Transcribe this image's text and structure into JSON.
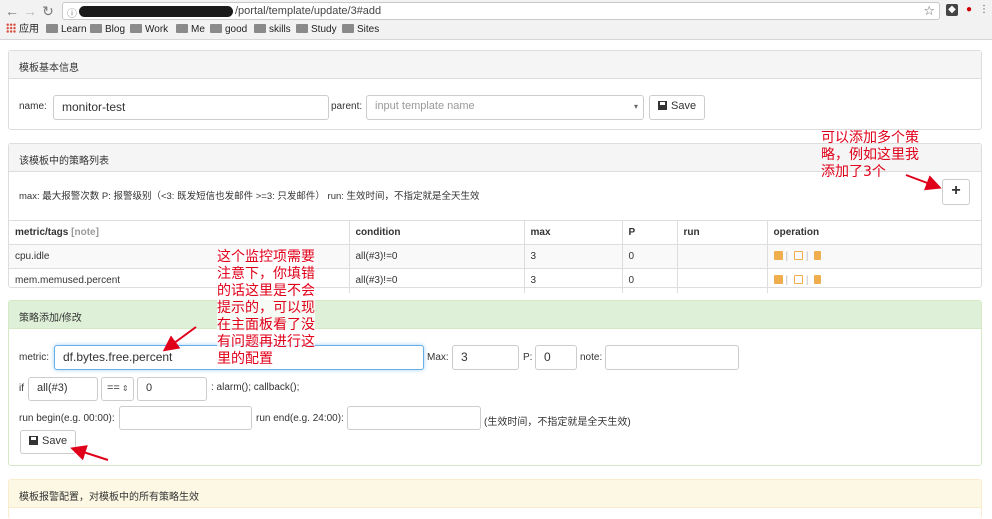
{
  "browser": {
    "url": "/portal/template/update/3#add",
    "bookmarks": [
      "应用",
      "Learn",
      "Blog",
      "Work",
      "Me",
      "good",
      "skills",
      "Study",
      "Sites"
    ]
  },
  "basic": {
    "title": "模板基本信息",
    "name_label": "name:",
    "name_value": "monitor-test",
    "parent_label": "parent:",
    "parent_placeholder": "input template name",
    "save_label": "Save"
  },
  "strategies": {
    "title": "该模板中的策略列表",
    "legend": "max: 最大报警次数 P: 报警级别（<3: 既发短信也发邮件 >=3: 只发邮件） run: 生效时间，不指定就是全天生效",
    "add_label": "+",
    "columns": [
      "metric/tags",
      "[note]",
      "condition",
      "max",
      "P",
      "run",
      "operation"
    ],
    "rows": [
      {
        "metric": "cpu.idle",
        "condition": "all(#3)!=0",
        "max": "3",
        "p": "0",
        "run": ""
      },
      {
        "metric": "mem.memused.percent",
        "condition": "all(#3)!=0",
        "max": "3",
        "p": "0",
        "run": ""
      }
    ]
  },
  "form": {
    "title": "策略添加/修改",
    "metric_label": "metric:",
    "metric_value": "df.bytes.free.percent",
    "max_label": "Max:",
    "max_value": "3",
    "p_label": "P:",
    "p_value": "0",
    "note_label": "note:",
    "if_label": "if",
    "func_value": "all(#3)",
    "op_value": "==",
    "threshold_value": "0",
    "actions_text": ": alarm(); callback();",
    "run_begin_label": "run begin(e.g. 00:00):",
    "run_end_label": "run end(e.g. 24:00):",
    "run_hint": "(生效时间，不指定就是全天生效)",
    "save_label": "Save"
  },
  "alarm": {
    "title": "模板报警配置，对模板中的所有策略生效"
  },
  "annotations": {
    "add_note": "可以添加多个策\n略，例如这里我\n添加了3个",
    "metric_note": "这个监控项需要\n注意下，你填错\n的话这里是不会\n提示的，可以现\n在主面板看了没\n有问题再进行这\n里的配置"
  },
  "colors": {
    "annotation": "#e0001a",
    "success_panel": "#dff0d8",
    "warning_panel": "#fcf8e3",
    "op_icon": "#f0ad4e"
  }
}
